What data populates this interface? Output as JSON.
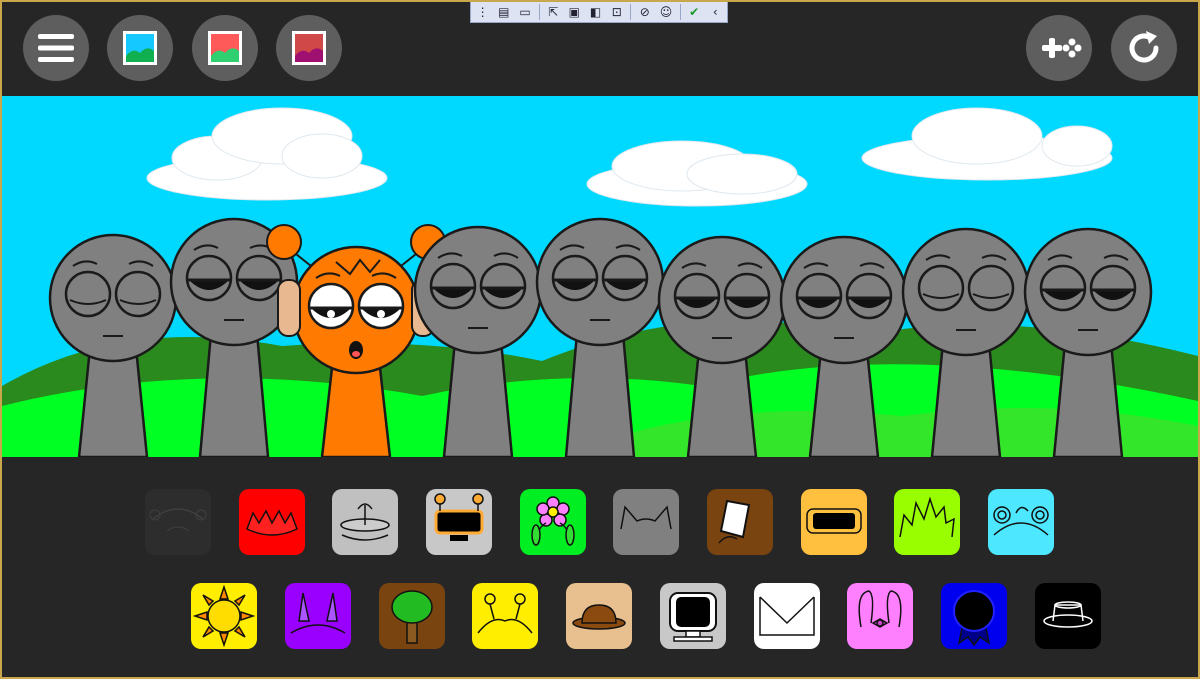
{
  "colors": {
    "background": "#262626",
    "button": "#5e5e5e",
    "sky": "#00d9ff",
    "grass": "#00ff22",
    "hill": "#2a8a1e",
    "character_gray": "#808080",
    "character_orange": "#ff7a00",
    "frame": "#c8a84a"
  },
  "top_left_buttons": [
    {
      "name": "menu-button",
      "icon": "hamburger-menu-icon"
    },
    {
      "name": "background-blue-button",
      "icon": "landscape-blue-icon"
    },
    {
      "name": "background-red-button",
      "icon": "landscape-red-icon"
    },
    {
      "name": "background-dark-button",
      "icon": "landscape-dark-icon"
    }
  ],
  "top_right_buttons": [
    {
      "name": "gamepad-button",
      "icon": "gamepad-icon"
    },
    {
      "name": "reset-button",
      "icon": "reset-icon"
    }
  ],
  "dev_toolbar": {
    "tools": [
      "grip-icon",
      "live-visual-tree-icon",
      "video-icon",
      "select-element-icon",
      "display-layout-adorners-icon",
      "track-focus-icon",
      "hot-reload-icon",
      "binding-failures-icon",
      "accessibility-icon",
      "checkmark-icon",
      "collapse-icon"
    ]
  },
  "stage": {
    "characters": [
      {
        "slot": 1,
        "color": "gray",
        "eyes": "closed"
      },
      {
        "slot": 2,
        "color": "gray",
        "eyes": "half-closed"
      },
      {
        "slot": 3,
        "color": "orange",
        "eyes": "half-closed",
        "accessory": "headphones"
      },
      {
        "slot": 4,
        "color": "gray",
        "eyes": "half-closed"
      },
      {
        "slot": 5,
        "color": "gray",
        "eyes": "half-closed"
      },
      {
        "slot": 6,
        "color": "gray",
        "eyes": "half-closed"
      },
      {
        "slot": 7,
        "color": "gray",
        "eyes": "half-closed"
      },
      {
        "slot": 8,
        "color": "gray",
        "eyes": "closed"
      },
      {
        "slot": 9,
        "color": "gray",
        "eyes": "half-closed"
      }
    ]
  },
  "accessory_row_1": [
    {
      "name": "dark-ears-icon",
      "color": "#333333",
      "used": true
    },
    {
      "name": "red-spikes-icon",
      "color": "#ff0000"
    },
    {
      "name": "antenna-dish-icon",
      "color": "#c0c0c0"
    },
    {
      "name": "orange-headphones-icon",
      "color": "#c8c8c8"
    },
    {
      "name": "flower-icon",
      "color": "#00ee22"
    },
    {
      "name": "gray-cat-ears-icon",
      "color": "#808080"
    },
    {
      "name": "bucket-icon",
      "color": "#7a4410"
    },
    {
      "name": "visor-icon",
      "color": "#ffc040"
    },
    {
      "name": "lime-spikes-icon",
      "color": "#99ff00"
    },
    {
      "name": "bear-ears-icon",
      "color": "#4de8ff"
    }
  ],
  "accessory_row_2": [
    {
      "name": "sun-icon",
      "color": "#ffee00"
    },
    {
      "name": "purple-horns-icon",
      "color": "#9900ff"
    },
    {
      "name": "tree-icon",
      "color": "#7a4410"
    },
    {
      "name": "yellow-antennae-icon",
      "color": "#ffee00"
    },
    {
      "name": "brown-hat-icon",
      "color": "#e8c090"
    },
    {
      "name": "monitor-icon",
      "color": "#c8c8c8"
    },
    {
      "name": "envelope-icon",
      "color": "#ffffff"
    },
    {
      "name": "pink-bunny-ears-icon",
      "color": "#ff80ff"
    },
    {
      "name": "blue-rosette-icon",
      "color": "#0000ee"
    },
    {
      "name": "black-hat-icon",
      "color": "#000000"
    }
  ]
}
